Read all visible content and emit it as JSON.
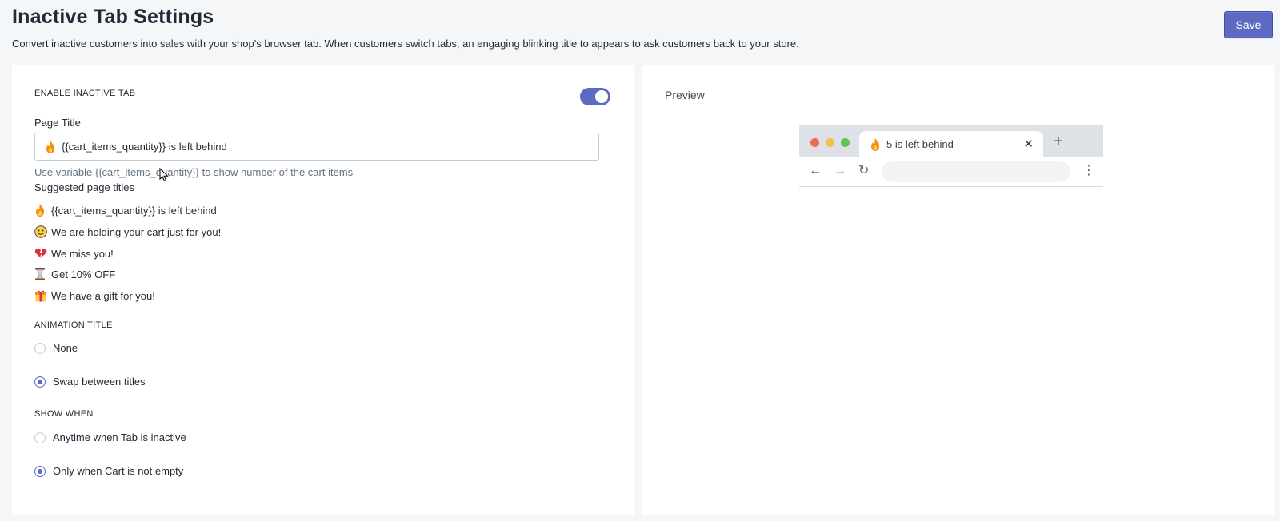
{
  "header": {
    "title": "Inactive Tab Settings",
    "subtitle": "Convert inactive customers into sales with your shop's browser tab. When customers switch tabs, an engaging blinking title to appears to ask customers back to your store.",
    "save_label": "Save"
  },
  "settings": {
    "enable_label": "ENABLE INACTIVE TAB",
    "enabled": true,
    "page_title_label": "Page Title",
    "page_title_value": "{{cart_items_quantity}} is left behind",
    "help_text": "Use variable {{cart_items_quantity}} to show number of the cart items",
    "suggested_label": "Suggested page titles",
    "suggestions": [
      {
        "icon": "fire-icon",
        "text": "{{cart_items_quantity}} is left behind"
      },
      {
        "icon": "smiley-icon",
        "text": "We are holding your cart just for you!"
      },
      {
        "icon": "broken-heart-icon",
        "text": "We miss you!"
      },
      {
        "icon": "hourglass-icon",
        "text": "Get 10% OFF"
      },
      {
        "icon": "gift-icon",
        "text": "We have a gift for you!"
      }
    ],
    "animation": {
      "label": "ANIMATION TITLE",
      "options": [
        {
          "label": "None",
          "checked": false
        },
        {
          "label": "Swap between titles",
          "checked": true
        }
      ]
    },
    "show_when": {
      "label": "SHOW WHEN",
      "options": [
        {
          "label": "Anytime when Tab is inactive",
          "checked": false
        },
        {
          "label": "Only when Cart is not empty",
          "checked": true
        }
      ]
    }
  },
  "preview": {
    "label": "Preview",
    "tab_title": "5 is left behind",
    "close_glyph": "✕",
    "new_tab_glyph": "+",
    "nav_glyphs": {
      "back": "←",
      "forward": "→",
      "reload": "↻",
      "menu": "⋮"
    }
  },
  "colors": {
    "accent": "#5c6ac4",
    "dot_red": "#ed6a5e",
    "dot_yellow": "#f5bf4f",
    "dot_green": "#61c554"
  }
}
